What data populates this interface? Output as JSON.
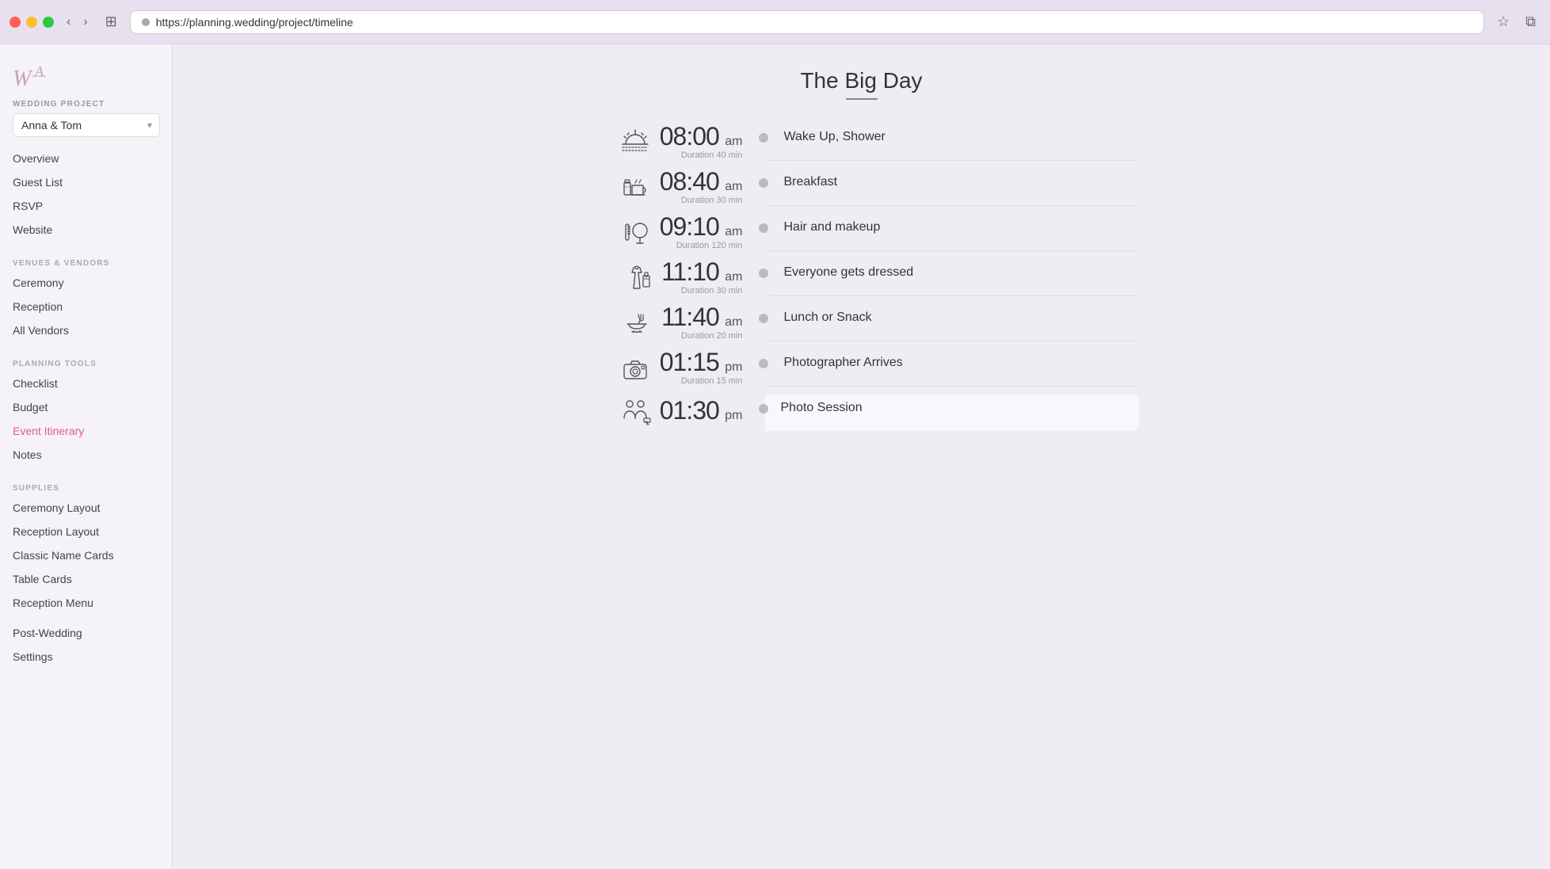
{
  "browser": {
    "url": "https://planning.wedding/project/timeline",
    "traffic_lights": [
      "red",
      "yellow",
      "green"
    ]
  },
  "sidebar": {
    "logo_text": "WA",
    "project_label": "WEDDING PROJECT",
    "project_name": "Anna & Tom",
    "nav_primary": [
      {
        "label": "Overview",
        "id": "overview"
      },
      {
        "label": "Guest List",
        "id": "guest-list"
      },
      {
        "label": "RSVP",
        "id": "rsvp"
      },
      {
        "label": "Website",
        "id": "website"
      }
    ],
    "section_venues": "VENUES & VENDORS",
    "nav_venues": [
      {
        "label": "Ceremony",
        "id": "ceremony"
      },
      {
        "label": "Reception",
        "id": "reception"
      },
      {
        "label": "All Vendors",
        "id": "all-vendors"
      }
    ],
    "section_planning": "PLANNING TOOLS",
    "nav_planning": [
      {
        "label": "Checklist",
        "id": "checklist"
      },
      {
        "label": "Budget",
        "id": "budget"
      },
      {
        "label": "Event Itinerary",
        "id": "event-itinerary",
        "active": true
      },
      {
        "label": "Notes",
        "id": "notes"
      }
    ],
    "section_supplies": "SUPPLIES",
    "nav_supplies": [
      {
        "label": "Ceremony Layout",
        "id": "ceremony-layout"
      },
      {
        "label": "Reception Layout",
        "id": "reception-layout"
      },
      {
        "label": "Classic Name Cards",
        "id": "classic-name-cards"
      },
      {
        "label": "Table Cards",
        "id": "table-cards"
      },
      {
        "label": "Reception Menu",
        "id": "reception-menu"
      }
    ],
    "nav_bottom": [
      {
        "label": "Post-Wedding",
        "id": "post-wedding"
      },
      {
        "label": "Settings",
        "id": "settings"
      }
    ]
  },
  "main": {
    "title": "The Big Day",
    "timeline_items": [
      {
        "time": "08:00",
        "period": "am",
        "duration": "Duration 40 min",
        "event": "Wake Up, Shower",
        "icon": "sunrise"
      },
      {
        "time": "08:40",
        "period": "am",
        "duration": "Duration 30 min",
        "event": "Breakfast",
        "icon": "breakfast"
      },
      {
        "time": "09:10",
        "period": "am",
        "duration": "Duration 120 min",
        "event": "Hair and makeup",
        "icon": "makeup"
      },
      {
        "time": "11:10",
        "period": "am",
        "duration": "Duration 30 min",
        "event": "Everyone gets dressed",
        "icon": "dress"
      },
      {
        "time": "11:40",
        "period": "am",
        "duration": "Duration 20 min",
        "event": "Lunch or Snack",
        "icon": "food"
      },
      {
        "time": "01:15",
        "period": "pm",
        "duration": "Duration 15 min",
        "event": "Photographer Arrives",
        "icon": "camera"
      },
      {
        "time": "01:30",
        "period": "pm",
        "duration": "",
        "event": "Photo Session",
        "icon": "people-photo",
        "highlight": true
      }
    ]
  }
}
